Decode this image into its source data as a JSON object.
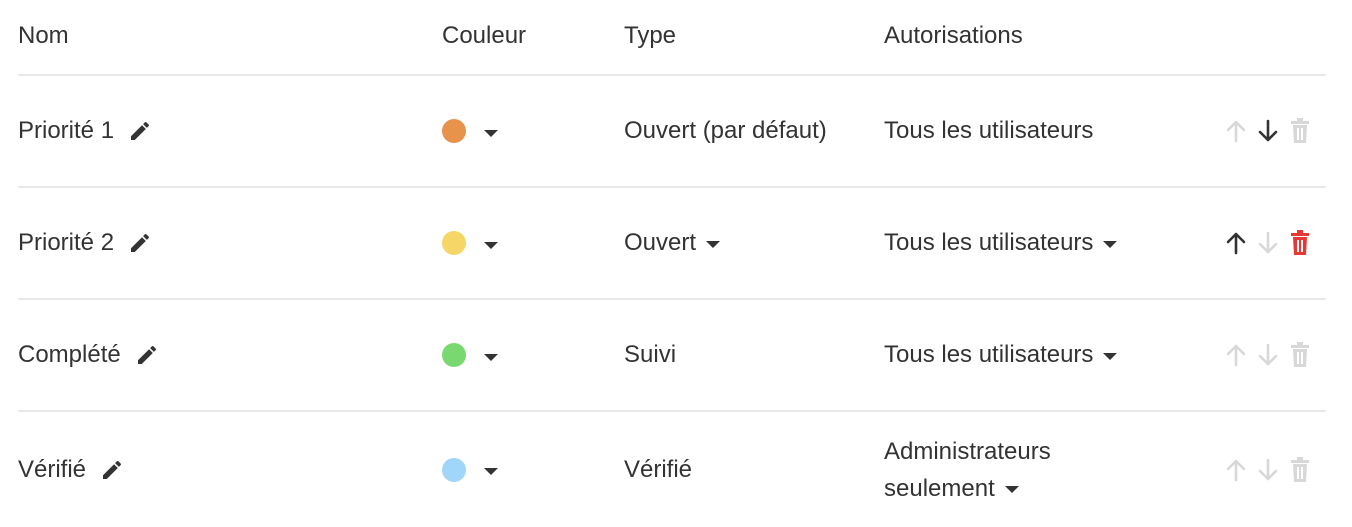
{
  "headers": {
    "name": "Nom",
    "color": "Couleur",
    "type": "Type",
    "permissions": "Autorisations"
  },
  "rows": [
    {
      "name": "Priorité 1",
      "color": "#e8934b",
      "type": "Ouvert (par défaut)",
      "type_dropdown": false,
      "permission": "Tous les utilisateurs",
      "permission_dropdown": false,
      "up_enabled": false,
      "down_enabled": true,
      "delete_enabled": false
    },
    {
      "name": "Priorité 2",
      "color": "#f6d667",
      "type": "Ouvert",
      "type_dropdown": true,
      "permission": "Tous les utilisateurs",
      "permission_dropdown": true,
      "up_enabled": true,
      "down_enabled": false,
      "delete_enabled": true
    },
    {
      "name": "Complété",
      "color": "#79d86f",
      "type": "Suivi",
      "type_dropdown": false,
      "permission": "Tous les utilisateurs",
      "permission_dropdown": true,
      "up_enabled": false,
      "down_enabled": false,
      "delete_enabled": false
    },
    {
      "name": "Vérifié",
      "color": "#9fd6f9",
      "type": "Vérifié",
      "type_dropdown": false,
      "permission_line1": "Administrateurs",
      "permission_line2": "seulement",
      "permission_dropdown": true,
      "up_enabled": false,
      "down_enabled": false,
      "delete_enabled": false
    }
  ],
  "colors": {
    "text": "#333333",
    "disabled_icon": "#d8d8d8",
    "delete_active": "#e53935",
    "divider": "#e8e8e8"
  },
  "icons": {
    "edit": "pencil-icon",
    "move_up": "arrow-up-icon",
    "move_down": "arrow-down-icon",
    "delete": "trash-icon",
    "dropdown": "caret-down-icon"
  }
}
